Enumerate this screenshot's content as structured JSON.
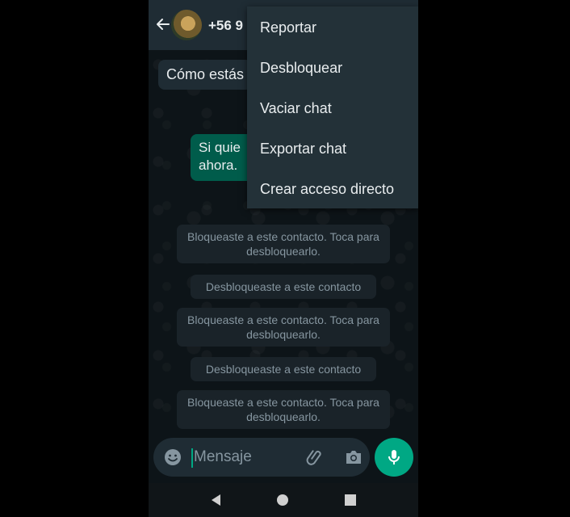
{
  "header": {
    "contact_name": "+56 9"
  },
  "messages": {
    "incoming_text": "Cómo estás",
    "outgoing_line1": "Si quie",
    "outgoing_line2": "ahora."
  },
  "system_messages": [
    "Bloqueaste a este contacto. Toca para desbloquearlo.",
    "Desbloqueaste a este contacto",
    "Bloqueaste a este contacto. Toca para desbloquearlo.",
    "Desbloqueaste a este contacto",
    "Bloqueaste a este contacto. Toca para desbloquearlo."
  ],
  "menu": {
    "items": [
      {
        "label": "Reportar"
      },
      {
        "label": "Desbloquear"
      },
      {
        "label": "Vaciar chat"
      },
      {
        "label": "Exportar chat"
      },
      {
        "label": "Crear acceso directo"
      }
    ]
  },
  "composer": {
    "placeholder": "Mensaje"
  },
  "colors": {
    "accent": "#00a884",
    "outgoing_bubble": "#005c4b",
    "header": "#1f2c34",
    "background": "#0d1418",
    "menu": "#233138"
  },
  "icons": {
    "back": "arrow-left",
    "emoji": "smiley",
    "attach": "paperclip",
    "camera": "camera",
    "mic": "microphone",
    "nav_back": "triangle-left",
    "nav_home": "circle",
    "nav_recents": "square"
  }
}
